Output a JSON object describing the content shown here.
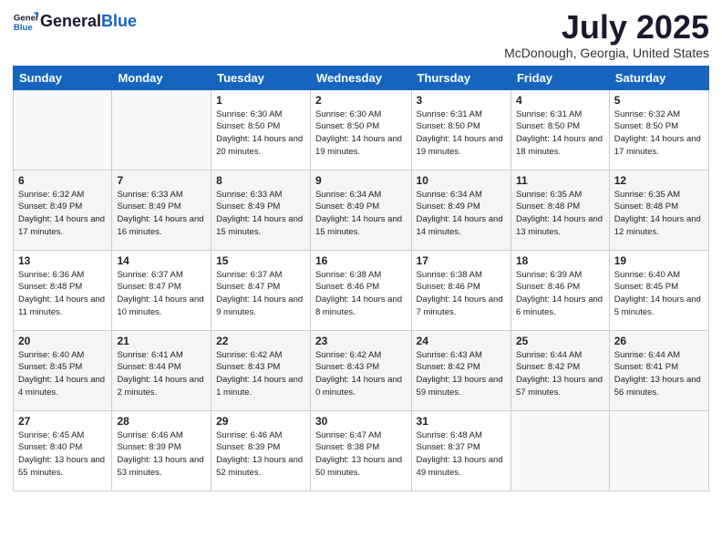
{
  "header": {
    "logo_general": "General",
    "logo_blue": "Blue",
    "month": "July 2025",
    "location": "McDonough, Georgia, United States"
  },
  "weekdays": [
    "Sunday",
    "Monday",
    "Tuesday",
    "Wednesday",
    "Thursday",
    "Friday",
    "Saturday"
  ],
  "weeks": [
    [
      {
        "day": "",
        "info": ""
      },
      {
        "day": "",
        "info": ""
      },
      {
        "day": "1",
        "info": "Sunrise: 6:30 AM\nSunset: 8:50 PM\nDaylight: 14 hours and 20 minutes."
      },
      {
        "day": "2",
        "info": "Sunrise: 6:30 AM\nSunset: 8:50 PM\nDaylight: 14 hours and 19 minutes."
      },
      {
        "day": "3",
        "info": "Sunrise: 6:31 AM\nSunset: 8:50 PM\nDaylight: 14 hours and 19 minutes."
      },
      {
        "day": "4",
        "info": "Sunrise: 6:31 AM\nSunset: 8:50 PM\nDaylight: 14 hours and 18 minutes."
      },
      {
        "day": "5",
        "info": "Sunrise: 6:32 AM\nSunset: 8:50 PM\nDaylight: 14 hours and 17 minutes."
      }
    ],
    [
      {
        "day": "6",
        "info": "Sunrise: 6:32 AM\nSunset: 8:49 PM\nDaylight: 14 hours and 17 minutes."
      },
      {
        "day": "7",
        "info": "Sunrise: 6:33 AM\nSunset: 8:49 PM\nDaylight: 14 hours and 16 minutes."
      },
      {
        "day": "8",
        "info": "Sunrise: 6:33 AM\nSunset: 8:49 PM\nDaylight: 14 hours and 15 minutes."
      },
      {
        "day": "9",
        "info": "Sunrise: 6:34 AM\nSunset: 8:49 PM\nDaylight: 14 hours and 15 minutes."
      },
      {
        "day": "10",
        "info": "Sunrise: 6:34 AM\nSunset: 8:49 PM\nDaylight: 14 hours and 14 minutes."
      },
      {
        "day": "11",
        "info": "Sunrise: 6:35 AM\nSunset: 8:48 PM\nDaylight: 14 hours and 13 minutes."
      },
      {
        "day": "12",
        "info": "Sunrise: 6:35 AM\nSunset: 8:48 PM\nDaylight: 14 hours and 12 minutes."
      }
    ],
    [
      {
        "day": "13",
        "info": "Sunrise: 6:36 AM\nSunset: 8:48 PM\nDaylight: 14 hours and 11 minutes."
      },
      {
        "day": "14",
        "info": "Sunrise: 6:37 AM\nSunset: 8:47 PM\nDaylight: 14 hours and 10 minutes."
      },
      {
        "day": "15",
        "info": "Sunrise: 6:37 AM\nSunset: 8:47 PM\nDaylight: 14 hours and 9 minutes."
      },
      {
        "day": "16",
        "info": "Sunrise: 6:38 AM\nSunset: 8:46 PM\nDaylight: 14 hours and 8 minutes."
      },
      {
        "day": "17",
        "info": "Sunrise: 6:38 AM\nSunset: 8:46 PM\nDaylight: 14 hours and 7 minutes."
      },
      {
        "day": "18",
        "info": "Sunrise: 6:39 AM\nSunset: 8:46 PM\nDaylight: 14 hours and 6 minutes."
      },
      {
        "day": "19",
        "info": "Sunrise: 6:40 AM\nSunset: 8:45 PM\nDaylight: 14 hours and 5 minutes."
      }
    ],
    [
      {
        "day": "20",
        "info": "Sunrise: 6:40 AM\nSunset: 8:45 PM\nDaylight: 14 hours and 4 minutes."
      },
      {
        "day": "21",
        "info": "Sunrise: 6:41 AM\nSunset: 8:44 PM\nDaylight: 14 hours and 2 minutes."
      },
      {
        "day": "22",
        "info": "Sunrise: 6:42 AM\nSunset: 8:43 PM\nDaylight: 14 hours and 1 minute."
      },
      {
        "day": "23",
        "info": "Sunrise: 6:42 AM\nSunset: 8:43 PM\nDaylight: 14 hours and 0 minutes."
      },
      {
        "day": "24",
        "info": "Sunrise: 6:43 AM\nSunset: 8:42 PM\nDaylight: 13 hours and 59 minutes."
      },
      {
        "day": "25",
        "info": "Sunrise: 6:44 AM\nSunset: 8:42 PM\nDaylight: 13 hours and 57 minutes."
      },
      {
        "day": "26",
        "info": "Sunrise: 6:44 AM\nSunset: 8:41 PM\nDaylight: 13 hours and 56 minutes."
      }
    ],
    [
      {
        "day": "27",
        "info": "Sunrise: 6:45 AM\nSunset: 8:40 PM\nDaylight: 13 hours and 55 minutes."
      },
      {
        "day": "28",
        "info": "Sunrise: 6:46 AM\nSunset: 8:39 PM\nDaylight: 13 hours and 53 minutes."
      },
      {
        "day": "29",
        "info": "Sunrise: 6:46 AM\nSunset: 8:39 PM\nDaylight: 13 hours and 52 minutes."
      },
      {
        "day": "30",
        "info": "Sunrise: 6:47 AM\nSunset: 8:38 PM\nDaylight: 13 hours and 50 minutes."
      },
      {
        "day": "31",
        "info": "Sunrise: 6:48 AM\nSunset: 8:37 PM\nDaylight: 13 hours and 49 minutes."
      },
      {
        "day": "",
        "info": ""
      },
      {
        "day": "",
        "info": ""
      }
    ]
  ]
}
